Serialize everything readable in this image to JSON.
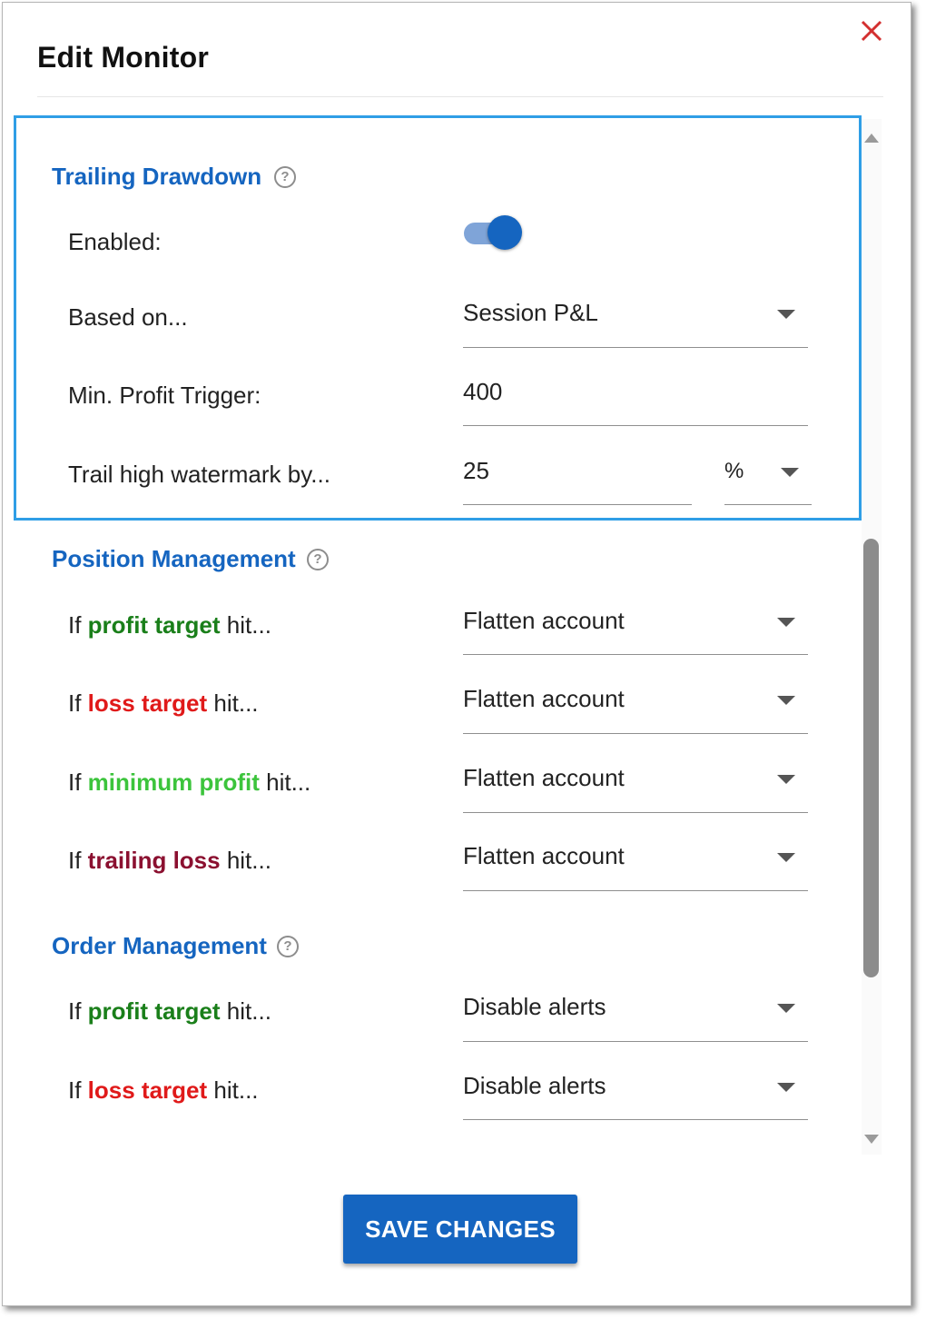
{
  "dialog": {
    "title": "Edit Monitor",
    "close_icon": "close-icon"
  },
  "colors": {
    "accent": "#1565c0",
    "highlight_border": "#2f9ee6",
    "profit_target": "#1a7f1a",
    "loss_target": "#e01a1a",
    "minimum_profit": "#3cc43c",
    "trailing_loss": "#8b1030"
  },
  "trailing_drawdown": {
    "title": "Trailing Drawdown",
    "help_icon": "?",
    "enabled_label": "Enabled:",
    "enabled_value": true,
    "based_on_label": "Based on...",
    "based_on_value": "Session P&L",
    "min_profit_label": "Min. Profit Trigger:",
    "min_profit_value": "400",
    "trail_label": "Trail high watermark by...",
    "trail_value": "25",
    "trail_unit": "%"
  },
  "position_management": {
    "title": "Position Management",
    "help_icon": "?",
    "rows": [
      {
        "prefix": "If ",
        "keyword": "profit target",
        "suffix": " hit...",
        "value": "Flatten account"
      },
      {
        "prefix": "If ",
        "keyword": "loss target",
        "suffix": " hit...",
        "value": "Flatten account"
      },
      {
        "prefix": "If ",
        "keyword": "minimum profit",
        "suffix": " hit...",
        "value": "Flatten account"
      },
      {
        "prefix": "If ",
        "keyword": "trailing loss",
        "suffix": " hit...",
        "value": "Flatten account"
      }
    ]
  },
  "order_management": {
    "title": "Order Management",
    "help_icon": "?",
    "rows": [
      {
        "prefix": "If ",
        "keyword": "profit target",
        "suffix": " hit...",
        "value": "Disable alerts"
      },
      {
        "prefix": "If ",
        "keyword": "loss target",
        "suffix": " hit...",
        "value": "Disable alerts"
      }
    ]
  },
  "footer": {
    "save_label": "SAVE CHANGES"
  }
}
